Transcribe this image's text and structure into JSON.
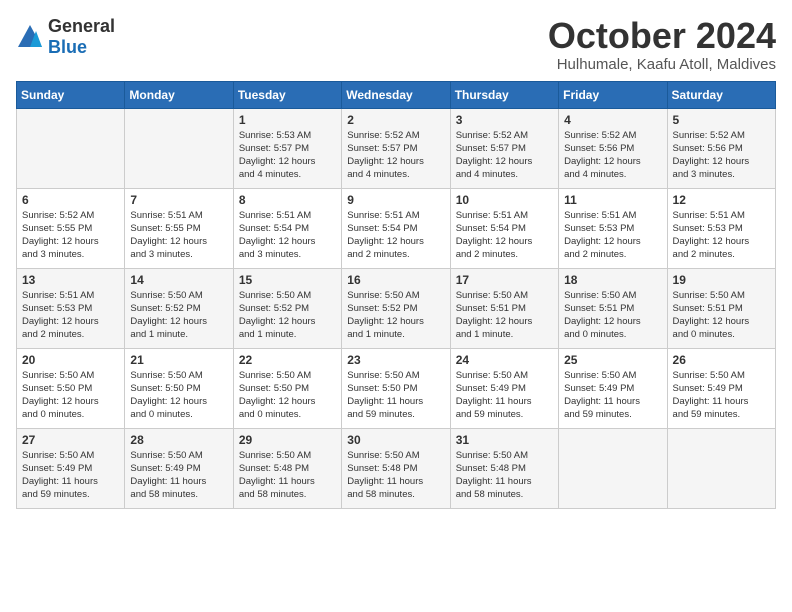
{
  "logo": {
    "general": "General",
    "blue": "Blue"
  },
  "header": {
    "month": "October 2024",
    "location": "Hulhumale, Kaafu Atoll, Maldives"
  },
  "weekdays": [
    "Sunday",
    "Monday",
    "Tuesday",
    "Wednesday",
    "Thursday",
    "Friday",
    "Saturday"
  ],
  "weeks": [
    [
      {
        "day": "",
        "info": ""
      },
      {
        "day": "",
        "info": ""
      },
      {
        "day": "1",
        "info": "Sunrise: 5:53 AM\nSunset: 5:57 PM\nDaylight: 12 hours\nand 4 minutes."
      },
      {
        "day": "2",
        "info": "Sunrise: 5:52 AM\nSunset: 5:57 PM\nDaylight: 12 hours\nand 4 minutes."
      },
      {
        "day": "3",
        "info": "Sunrise: 5:52 AM\nSunset: 5:57 PM\nDaylight: 12 hours\nand 4 minutes."
      },
      {
        "day": "4",
        "info": "Sunrise: 5:52 AM\nSunset: 5:56 PM\nDaylight: 12 hours\nand 4 minutes."
      },
      {
        "day": "5",
        "info": "Sunrise: 5:52 AM\nSunset: 5:56 PM\nDaylight: 12 hours\nand 3 minutes."
      }
    ],
    [
      {
        "day": "6",
        "info": "Sunrise: 5:52 AM\nSunset: 5:55 PM\nDaylight: 12 hours\nand 3 minutes."
      },
      {
        "day": "7",
        "info": "Sunrise: 5:51 AM\nSunset: 5:55 PM\nDaylight: 12 hours\nand 3 minutes."
      },
      {
        "day": "8",
        "info": "Sunrise: 5:51 AM\nSunset: 5:54 PM\nDaylight: 12 hours\nand 3 minutes."
      },
      {
        "day": "9",
        "info": "Sunrise: 5:51 AM\nSunset: 5:54 PM\nDaylight: 12 hours\nand 2 minutes."
      },
      {
        "day": "10",
        "info": "Sunrise: 5:51 AM\nSunset: 5:54 PM\nDaylight: 12 hours\nand 2 minutes."
      },
      {
        "day": "11",
        "info": "Sunrise: 5:51 AM\nSunset: 5:53 PM\nDaylight: 12 hours\nand 2 minutes."
      },
      {
        "day": "12",
        "info": "Sunrise: 5:51 AM\nSunset: 5:53 PM\nDaylight: 12 hours\nand 2 minutes."
      }
    ],
    [
      {
        "day": "13",
        "info": "Sunrise: 5:51 AM\nSunset: 5:53 PM\nDaylight: 12 hours\nand 2 minutes."
      },
      {
        "day": "14",
        "info": "Sunrise: 5:50 AM\nSunset: 5:52 PM\nDaylight: 12 hours\nand 1 minute."
      },
      {
        "day": "15",
        "info": "Sunrise: 5:50 AM\nSunset: 5:52 PM\nDaylight: 12 hours\nand 1 minute."
      },
      {
        "day": "16",
        "info": "Sunrise: 5:50 AM\nSunset: 5:52 PM\nDaylight: 12 hours\nand 1 minute."
      },
      {
        "day": "17",
        "info": "Sunrise: 5:50 AM\nSunset: 5:51 PM\nDaylight: 12 hours\nand 1 minute."
      },
      {
        "day": "18",
        "info": "Sunrise: 5:50 AM\nSunset: 5:51 PM\nDaylight: 12 hours\nand 0 minutes."
      },
      {
        "day": "19",
        "info": "Sunrise: 5:50 AM\nSunset: 5:51 PM\nDaylight: 12 hours\nand 0 minutes."
      }
    ],
    [
      {
        "day": "20",
        "info": "Sunrise: 5:50 AM\nSunset: 5:50 PM\nDaylight: 12 hours\nand 0 minutes."
      },
      {
        "day": "21",
        "info": "Sunrise: 5:50 AM\nSunset: 5:50 PM\nDaylight: 12 hours\nand 0 minutes."
      },
      {
        "day": "22",
        "info": "Sunrise: 5:50 AM\nSunset: 5:50 PM\nDaylight: 12 hours\nand 0 minutes."
      },
      {
        "day": "23",
        "info": "Sunrise: 5:50 AM\nSunset: 5:50 PM\nDaylight: 11 hours\nand 59 minutes."
      },
      {
        "day": "24",
        "info": "Sunrise: 5:50 AM\nSunset: 5:49 PM\nDaylight: 11 hours\nand 59 minutes."
      },
      {
        "day": "25",
        "info": "Sunrise: 5:50 AM\nSunset: 5:49 PM\nDaylight: 11 hours\nand 59 minutes."
      },
      {
        "day": "26",
        "info": "Sunrise: 5:50 AM\nSunset: 5:49 PM\nDaylight: 11 hours\nand 59 minutes."
      }
    ],
    [
      {
        "day": "27",
        "info": "Sunrise: 5:50 AM\nSunset: 5:49 PM\nDaylight: 11 hours\nand 59 minutes."
      },
      {
        "day": "28",
        "info": "Sunrise: 5:50 AM\nSunset: 5:49 PM\nDaylight: 11 hours\nand 58 minutes."
      },
      {
        "day": "29",
        "info": "Sunrise: 5:50 AM\nSunset: 5:48 PM\nDaylight: 11 hours\nand 58 minutes."
      },
      {
        "day": "30",
        "info": "Sunrise: 5:50 AM\nSunset: 5:48 PM\nDaylight: 11 hours\nand 58 minutes."
      },
      {
        "day": "31",
        "info": "Sunrise: 5:50 AM\nSunset: 5:48 PM\nDaylight: 11 hours\nand 58 minutes."
      },
      {
        "day": "",
        "info": ""
      },
      {
        "day": "",
        "info": ""
      }
    ]
  ]
}
